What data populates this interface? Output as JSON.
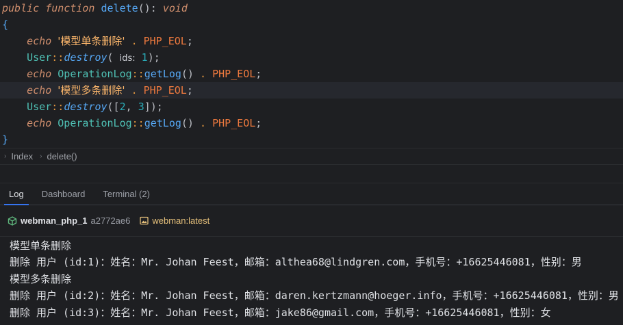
{
  "editor": {
    "lines": [
      {
        "kind": "signature",
        "kw1": "public",
        "kw2": "function",
        "name": "delete",
        "paren": "()",
        "colon": ":",
        "ret": "void"
      },
      {
        "kind": "brace",
        "text": "{"
      },
      {
        "kind": "echo-str",
        "echo": "echo",
        "str": "'模型单条删除'",
        "dot": ".",
        "const": "PHP_EOL",
        "semi": ";"
      },
      {
        "kind": "destroy-hint",
        "cls": "User",
        "sep": "::",
        "method": "destroy",
        "open": "(",
        "hint": "ids:",
        "num": "1",
        "close": ");"
      },
      {
        "kind": "echo-log",
        "echo": "echo",
        "cls": "OperationLog",
        "sep": "::",
        "method": "getLog",
        "paren": "()",
        "dot": ".",
        "const": "PHP_EOL",
        "semi": ";"
      },
      {
        "kind": "echo-str",
        "echo": "echo",
        "str": "'模型多条删除'",
        "dot": ".",
        "const": "PHP_EOL",
        "semi": ";"
      },
      {
        "kind": "destroy-arr",
        "cls": "User",
        "sep": "::",
        "method": "destroy",
        "open": "([",
        "n1": "2",
        "comma": ",",
        "n2": "3",
        "close": "]);"
      },
      {
        "kind": "echo-log",
        "echo": "echo",
        "cls": "OperationLog",
        "sep": "::",
        "method": "getLog",
        "paren": "()",
        "dot": ".",
        "const": "PHP_EOL",
        "semi": ";"
      },
      {
        "kind": "brace",
        "text": "}"
      }
    ]
  },
  "breadcrumb": {
    "items": [
      "Index",
      "delete()"
    ]
  },
  "tabs": [
    {
      "label": "Log",
      "active": true
    },
    {
      "label": "Dashboard",
      "active": false
    },
    {
      "label": "Terminal (2)",
      "active": false
    }
  ],
  "container": {
    "name": "webman_php_1",
    "id": "a2772ae6",
    "image": "webman:latest"
  },
  "log": {
    "lines": [
      "模型单条删除",
      "删除 用户 (id:1)：姓名：Mr. Johan Feest，邮箱：althea68@lindgren.com，手机号：+16625446081，性别：男",
      "模型多条删除",
      "删除 用户 (id:2)：姓名：Mr. Johan Feest，邮箱：daren.kertzmann@hoeger.info，手机号：+16625446081，性别：男",
      "删除 用户 (id:3)：姓名：Mr. Johan Feest，邮箱：jake86@gmail.com，手机号：+16625446081，性别：女"
    ]
  },
  "colors": {
    "accent": "#3574f0",
    "image_label": "#e5c07b",
    "container_icon": "#5fb77d"
  }
}
